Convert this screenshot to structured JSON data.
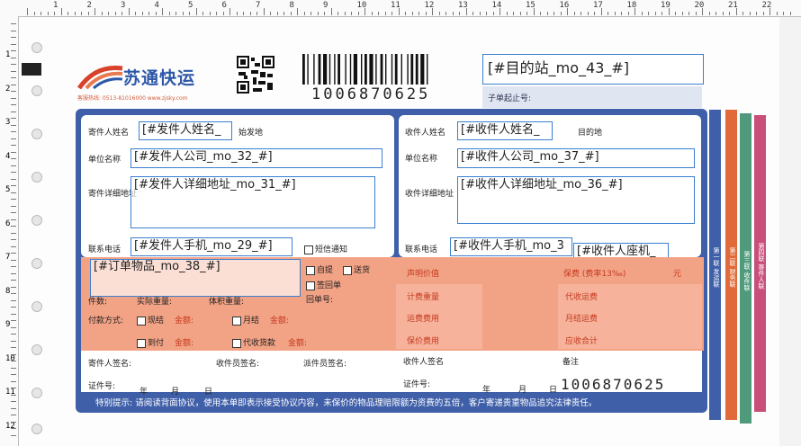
{
  "ruler": {
    "top": [
      "1",
      "2",
      "3",
      "4",
      "5",
      "6",
      "7",
      "8",
      "9",
      "10",
      "11",
      "12",
      "13",
      "14",
      "15",
      "16",
      "17",
      "18",
      "19",
      "20",
      "21",
      "22"
    ],
    "left": [
      "1",
      "2",
      "3",
      "4",
      "5",
      "6",
      "7",
      "8",
      "9",
      "10",
      "11",
      "12"
    ]
  },
  "header": {
    "brand": "苏通快运",
    "slogan": "客服热线: 0513-81016000 www.zjsky.com",
    "barcode_number": "1006870625",
    "destination_field": "[#目的站_mo_43_#]",
    "sub_order_label": "子单起止号:"
  },
  "sender": {
    "name_label": "寄件人姓名",
    "name_field": "[#发件人姓名_",
    "origin_label": "始发地",
    "company_label": "单位名称",
    "company_field": "[#发件人公司_mo_32_#]",
    "address_label": "寄件详细地址",
    "address_field": "[#发件人详细地址_mo_31_#]",
    "phone_label": "联系电话",
    "phone_field": "[#发件人手机_mo_29_#]",
    "sms_label": "短信通知"
  },
  "receiver": {
    "name_label": "收件人姓名",
    "name_field": "[#收件人姓名_",
    "dest_label": "目的地",
    "company_label": "单位名称",
    "company_field": "[#收件人公司_mo_37_#]",
    "address_label": "收件详细地址",
    "address_field": "[#收件人详细地址_mo_36_#]",
    "phone_label": "联系电话",
    "phone_field": "[#收件人手机_mo_3",
    "landline_field": "[#收件人座机_"
  },
  "goods": {
    "item_field": "[#订单物品_mo_38_#]",
    "pickup_label": "自提",
    "delivery_label": "送货",
    "sign_return_label": "签回单",
    "pieces_label": "件数:",
    "actual_weight_label": "实际重量:",
    "volume_weight_label": "体积重量:",
    "return_no_label": "回单号:",
    "declared_value_label": "声明价值",
    "insurance_label": "保费 (费率13‰)",
    "yuan": "元"
  },
  "fees": {
    "billed_weight": "计费重量",
    "freight": "运费费用",
    "collect_fee": "保价费用",
    "cod_fee": "代收运费",
    "monthly_fee": "月结运费",
    "total": "应收合计"
  },
  "payment": {
    "label": "付款方式:",
    "cash": "现结",
    "monthly": "月结",
    "collect": "到付",
    "cod": "代收货款",
    "amount": "金额:"
  },
  "signatures": {
    "sender_sign": "寄件人签名:",
    "courier_sign": "收件员签名:",
    "dispatcher_sign": "派件员签名:",
    "receiver_sign": "收件人签名",
    "remarks": "备注",
    "id_label": "证件号:",
    "year": "年",
    "month": "月",
    "day": "日"
  },
  "track_number": "1006870625",
  "strips": [
    "第一联 发运联",
    "第二联 财务联",
    "第三联 收件联",
    "第四联 寄件人联"
  ],
  "notice": "特别提示: 请阅读背面协议，使用本单即表示接受协议内容，未保价的物品理赔限额为资费的五倍，客户寄递贵重物品追究法律责任。"
}
